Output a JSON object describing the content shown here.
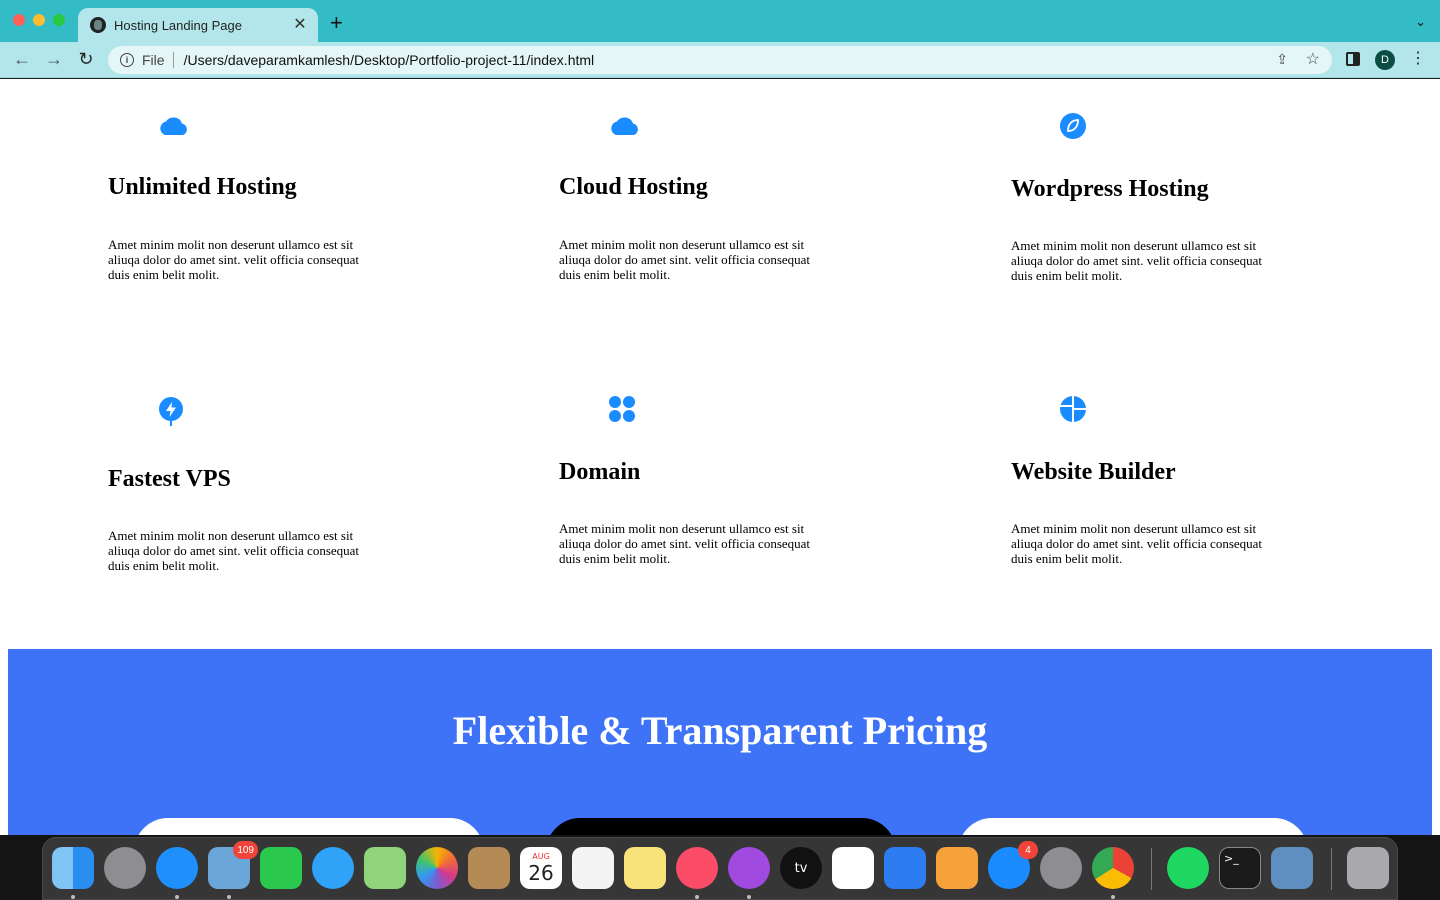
{
  "browser": {
    "tab_title": "Hosting Landing Page",
    "close_glyph": "✕",
    "new_tab_glyph": "+",
    "tab_menu_glyph": "⌄",
    "url_scheme": "File",
    "url": "/Users/daveparamkamlesh/Desktop/Portfolio-project-11/index.html",
    "profile_initial": "D",
    "back_glyph": "←",
    "forward_glyph": "→",
    "reload_glyph": "↻",
    "info_glyph": "i",
    "share_glyph": "⇪",
    "star_glyph": "☆",
    "menu_glyph": "⋮"
  },
  "features": [
    {
      "title": "Unlimited Hosting",
      "text": "Amet minim molit non deserunt ullamco est sit aliuqa dolor do amet sint. velit officia consequat duis enim belit molit.",
      "icon": "cloud-icon"
    },
    {
      "title": "Cloud Hosting",
      "text": "Amet minim molit non deserunt ullamco est sit aliuqa dolor do amet sint. velit officia consequat duis enim belit molit.",
      "icon": "cloud-icon"
    },
    {
      "title": "Wordpress Hosting",
      "text": "Amet minim molit non deserunt ullamco est sit aliuqa dolor do amet sint. velit officia consequat duis enim belit molit.",
      "icon": "leaf-icon"
    },
    {
      "title": "Fastest VPS",
      "text": "Amet minim molit non deserunt ullamco est sit aliuqa dolor do amet sint. velit officia consequat duis enim belit molit.",
      "icon": "bolt-pin-icon"
    },
    {
      "title": "Domain",
      "text": "Amet minim molit non deserunt ullamco est sit aliuqa dolor do amet sint. velit officia consequat duis enim belit molit.",
      "icon": "grid-dots-icon"
    },
    {
      "title": "Website Builder",
      "text": "Amet minim molit non deserunt ullamco est sit aliuqa dolor do amet sint. velit officia consequat duis enim belit molit.",
      "icon": "pie-icon"
    }
  ],
  "pricing": {
    "title": "Flexible & Transparent Pricing"
  },
  "colors": {
    "chrome_tab_bar": "#33bcc6",
    "chrome_toolbar": "#b3e6ea",
    "icon_blue": "#1a8cff",
    "pricing_bg": "#3e73f7"
  },
  "dock": {
    "mail_badge": "109",
    "calendar_month": "AUG",
    "calendar_day": "26",
    "appstore_badge": "4",
    "tv_label": "tv",
    "terminal_prompt": ">_"
  }
}
